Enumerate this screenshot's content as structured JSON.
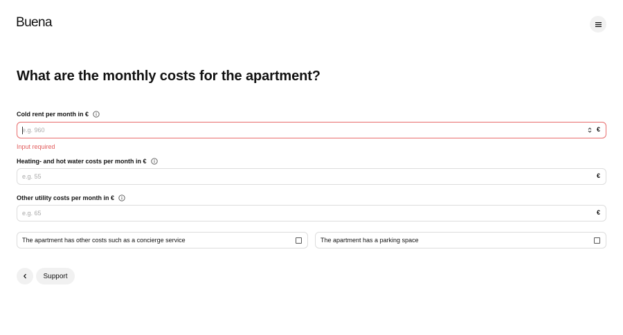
{
  "header": {
    "logo": "Buena",
    "menu_icon": "hamburger-menu-icon"
  },
  "page": {
    "title": "What are the monthly costs for the apartment?"
  },
  "fields": [
    {
      "label": "Cold rent per month in €",
      "placeholder": "e.g. 960",
      "suffix": "€",
      "error": "Input required",
      "has_spinner": true,
      "error_color": "#e86a6a"
    },
    {
      "label": "Heating- and hot water costs per month in €",
      "placeholder": "e.g. 55",
      "suffix": "€"
    },
    {
      "label": "Other utility costs per month in €",
      "placeholder": "e.g. 65",
      "suffix": "€"
    }
  ],
  "checkboxes": [
    {
      "label": "The apartment has other costs such as a concierge service",
      "checked": false
    },
    {
      "label": "The apartment has a parking space",
      "checked": false
    }
  ],
  "footer": {
    "back_icon": "chevron-left-icon",
    "support_label": "Support"
  },
  "colors": {
    "error": "#e15b5b",
    "button_bg": "#f1f1f1",
    "border": "#dcdcdc"
  }
}
